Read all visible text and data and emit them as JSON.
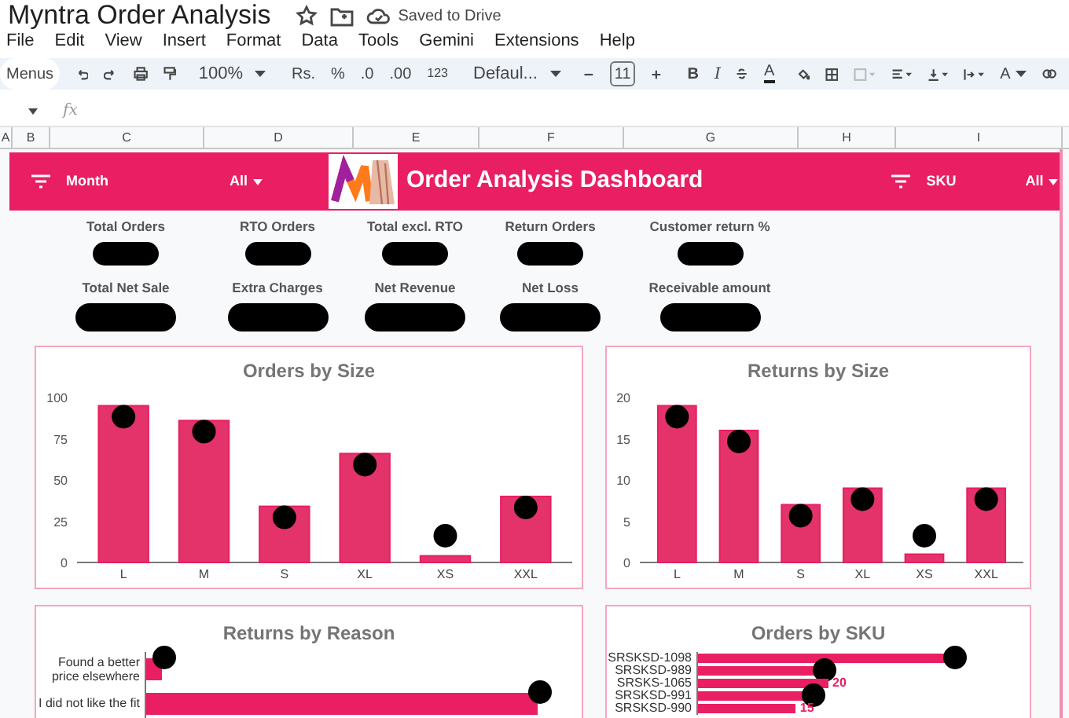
{
  "doc_title": "Myntra Order Analysis",
  "save_status": "Saved to Drive",
  "menu": [
    "File",
    "Edit",
    "View",
    "Insert",
    "Format",
    "Data",
    "Tools",
    "Gemini",
    "Extensions",
    "Help"
  ],
  "toolbar": {
    "menus_search": "Menus",
    "zoom": "100%",
    "currency": "Rs.",
    "percent": "%",
    "decrease_decimal": ".0",
    "increase_decimal": ".00",
    "number_format": "123",
    "font": "Defaul...",
    "font_size": "11",
    "bold": "B",
    "italic": "I",
    "text_color": "A",
    "text_rotation": "A"
  },
  "formula_bar": {
    "fx": "fx"
  },
  "columns": [
    "A",
    "B",
    "C",
    "D",
    "E",
    "F",
    "G",
    "H",
    "I"
  ],
  "header": {
    "title": "Order Analysis Dashboard",
    "filters": [
      {
        "label": "Month",
        "value": "All"
      },
      {
        "label": "SKU",
        "value": "All"
      }
    ]
  },
  "kpis": [
    [
      {
        "label": "Total Orders",
        "redacted": true
      },
      {
        "label": "RTO Orders",
        "redacted": true
      },
      {
        "label": "Total excl. RTO",
        "redacted": true
      },
      {
        "label": "Return Orders",
        "redacted": true
      },
      {
        "label": "Customer return %",
        "redacted": true
      }
    ],
    [
      {
        "label": "Total Net Sale",
        "redacted": true
      },
      {
        "label": "Extra Charges",
        "redacted": true
      },
      {
        "label": "Net Revenue",
        "redacted": true
      },
      {
        "label": "Net Loss",
        "redacted": true
      },
      {
        "label": "Receivable amount",
        "redacted": true
      }
    ]
  ],
  "orders_by_size": {
    "redacted": true,
    "chart_data": {
      "type": "bar",
      "title": "Orders by Size",
      "categories": [
        "L",
        "M",
        "S",
        "XL",
        "XS",
        "XXL"
      ],
      "series": [
        {
          "color": "#e3336a",
          "values": [
            95,
            86,
            34,
            66,
            4,
            40
          ]
        }
      ],
      "ylim": [
        0,
        100
      ],
      "yticks": [
        0,
        25,
        50,
        75,
        100
      ]
    }
  },
  "returns_by_size": {
    "redacted": true,
    "chart_data": {
      "type": "bar",
      "title": "Returns by Size",
      "categories": [
        "L",
        "M",
        "S",
        "XL",
        "XS",
        "XXL"
      ],
      "series": [
        {
          "color": "#e3336a",
          "values": [
            19,
            16,
            7,
            9,
            1,
            9
          ]
        }
      ],
      "ylim": [
        0,
        20
      ],
      "yticks": [
        0,
        5,
        10,
        15,
        20
      ]
    }
  },
  "returns_by_reason": {
    "title": "Returns by Reason",
    "bars": [
      {
        "label": "Found a better price elsewhere",
        "redacted": true
      },
      {
        "label": "I did not like the fit",
        "redacted": true
      }
    ]
  },
  "orders_by_sku": {
    "title": "Orders by SKU",
    "bars": [
      {
        "label": "SRSKSD-1098",
        "redacted": true
      },
      {
        "label": "SRSKSD-989",
        "redacted": true
      },
      {
        "label": "SRSKS-1065",
        "value_label": "20"
      },
      {
        "label": "SRSKSD-991",
        "redacted": true
      },
      {
        "label": "SRSKSD-990",
        "value_label": "15"
      }
    ]
  }
}
